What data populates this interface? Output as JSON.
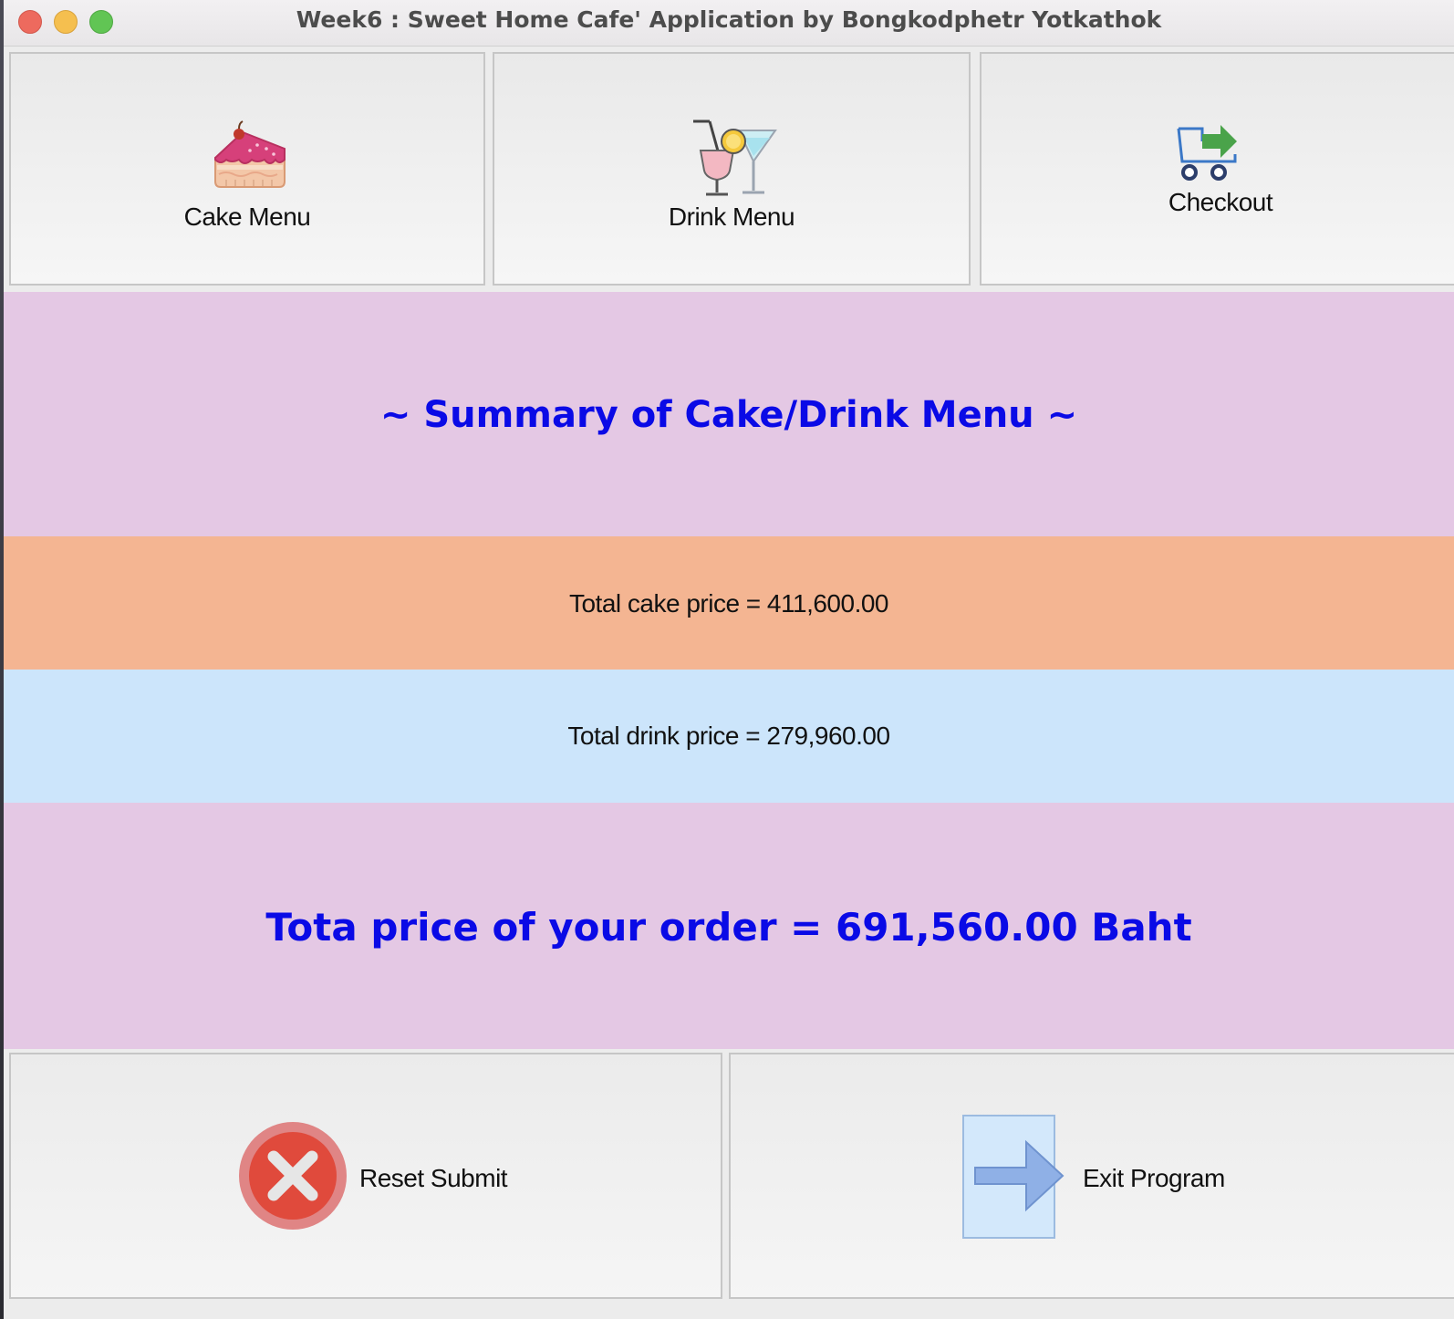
{
  "window": {
    "title": "Week6 : Sweet Home Cafe' Application by Bongkodphetr Yotkathok"
  },
  "top_buttons": {
    "cake_menu": {
      "label": "Cake Menu",
      "icon": "cake-slice-icon"
    },
    "drink_menu": {
      "label": "Drink Menu",
      "icon": "cocktail-icon"
    },
    "checkout": {
      "label": "Checkout",
      "icon": "cart-checkout-icon"
    }
  },
  "summary": {
    "heading": "~ Summary of Cake/Drink Menu ~",
    "cake_total": "Total cake price = 411,600.00",
    "drink_total": "Total drink price = 279,960.00",
    "order_total": "Tota price of your order = 691,560.00 Baht"
  },
  "bottom_buttons": {
    "reset": {
      "label": "Reset Submit",
      "icon": "cancel-x-icon"
    },
    "exit": {
      "label": "Exit Program",
      "icon": "arrow-right-icon"
    }
  },
  "colors": {
    "heading_text": "#0a0ae6",
    "summary_band": "#e4c8e4",
    "cake_band": "#f4b592",
    "drink_band": "#cce5fb"
  }
}
